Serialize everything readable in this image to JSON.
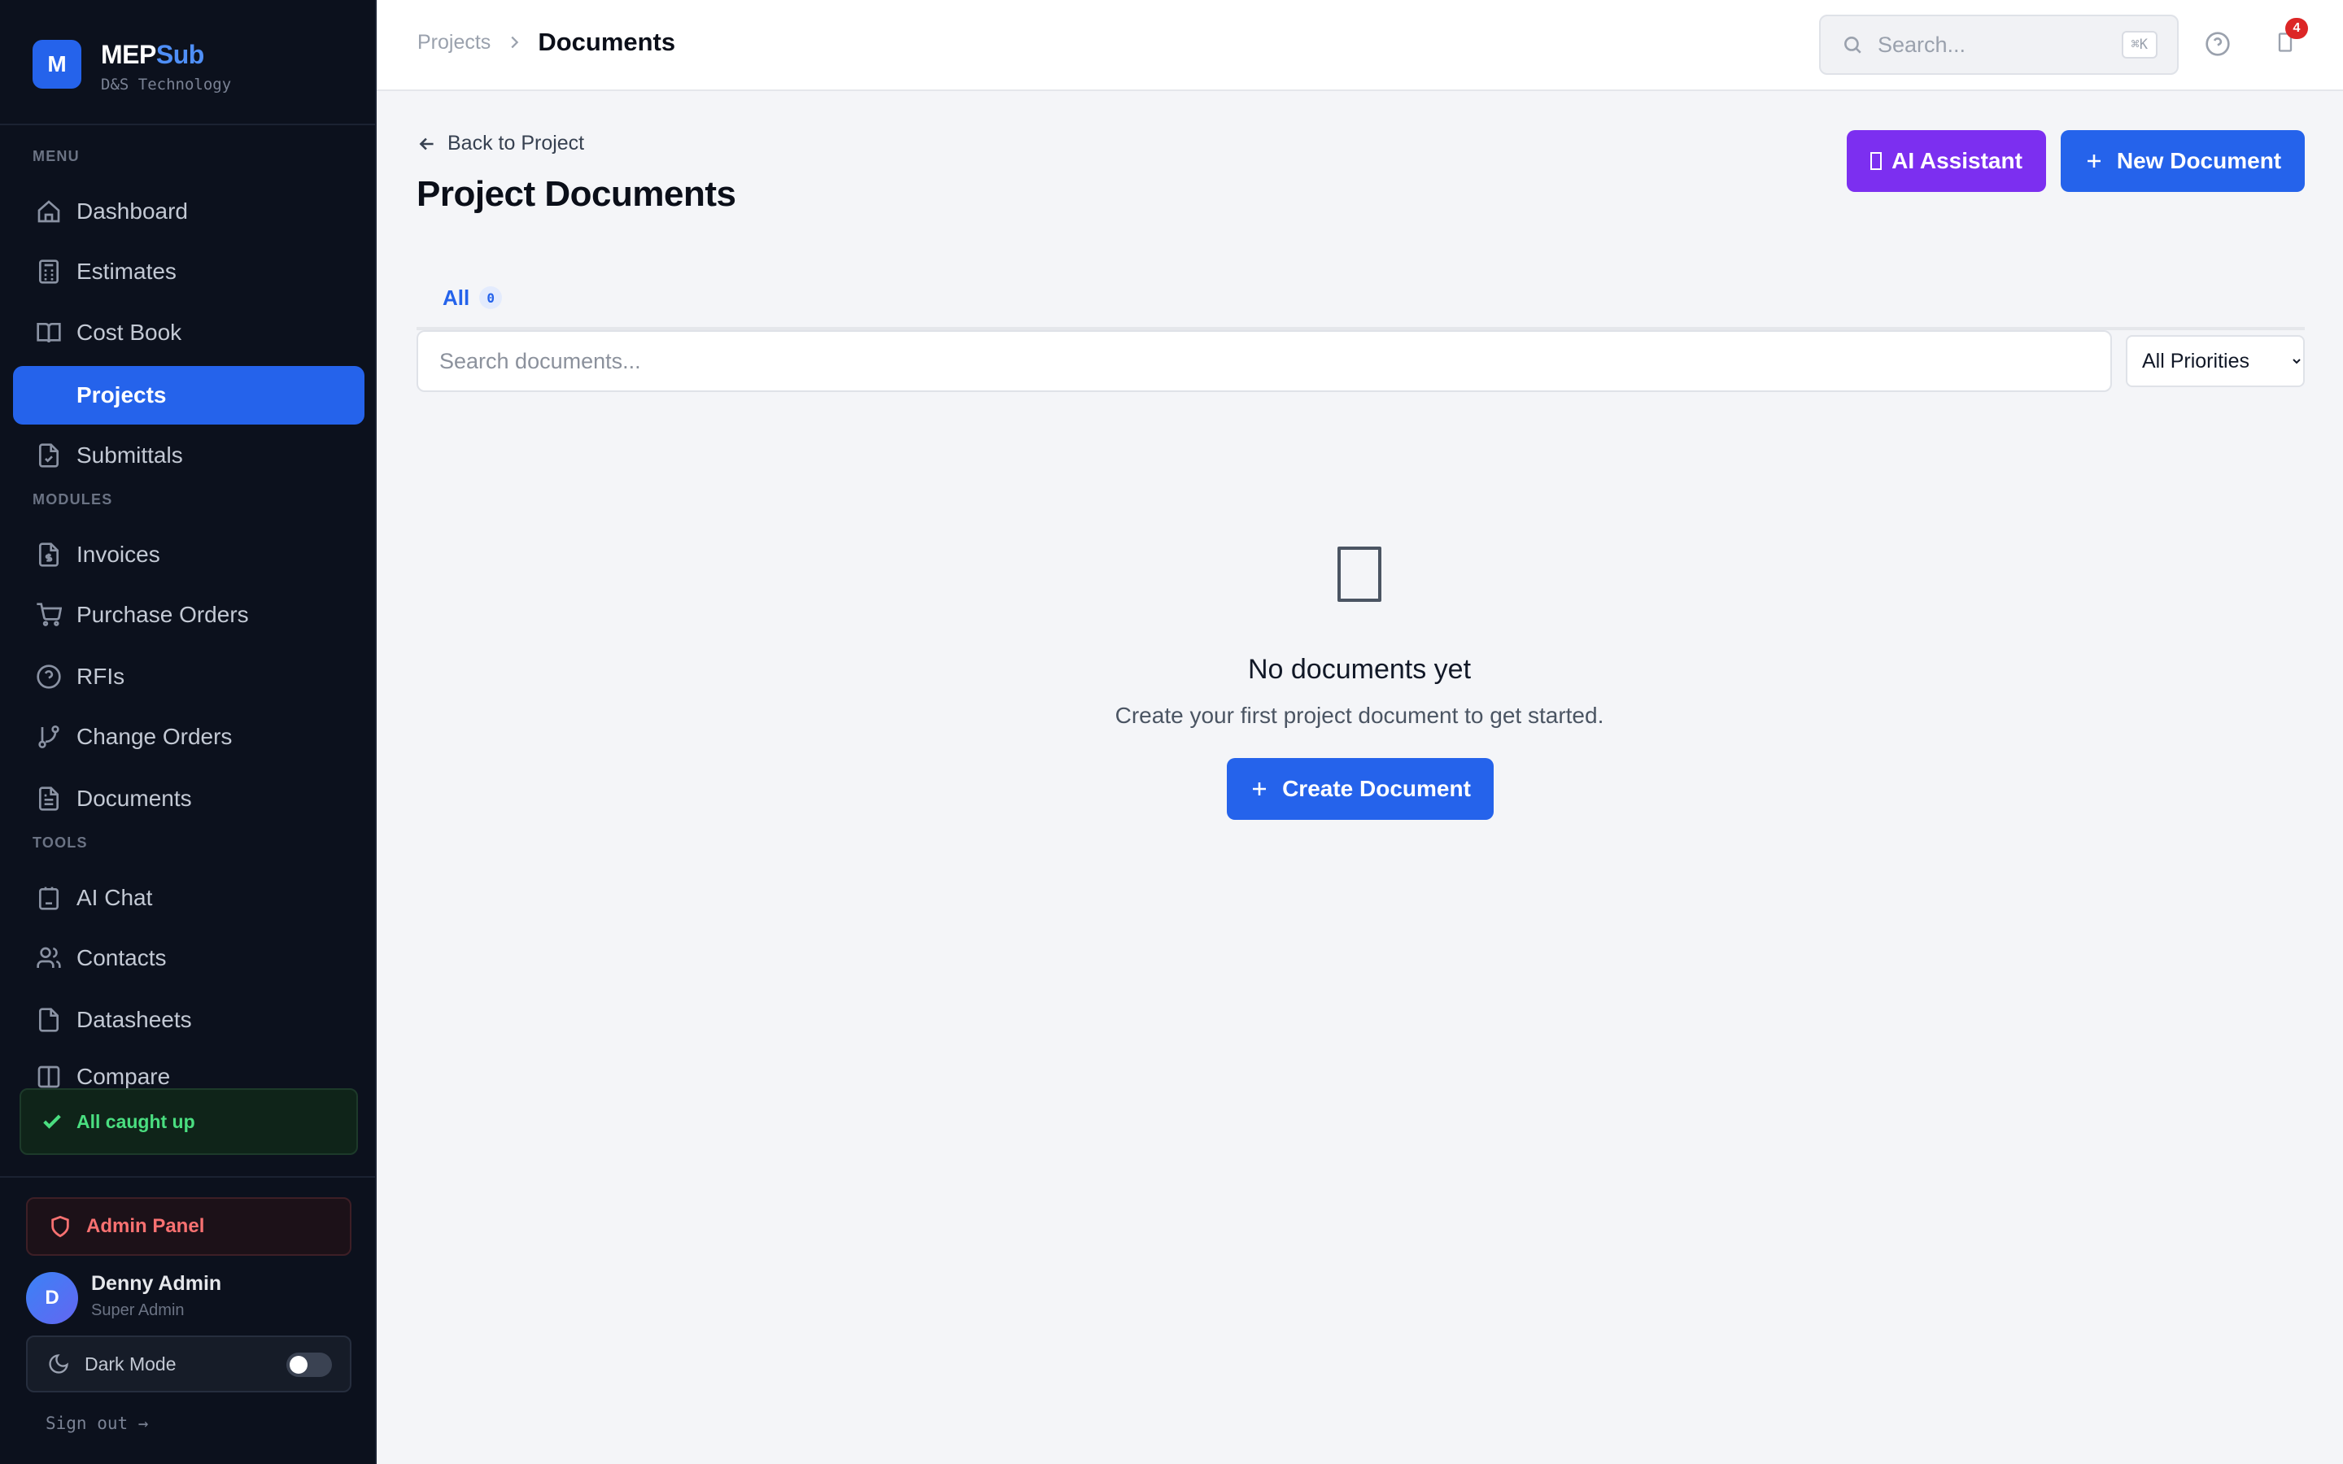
{
  "brand": {
    "logo_letter": "M",
    "name_part1": "MEP",
    "name_part2": "Sub",
    "company": "D&S Technology"
  },
  "sidebar": {
    "menu_label": "MENU",
    "menu": [
      {
        "label": "Dashboard",
        "icon": "home-icon"
      },
      {
        "label": "Estimates",
        "icon": "calculator-icon"
      },
      {
        "label": "Cost Book",
        "icon": "book-icon"
      },
      {
        "label": "Projects",
        "icon": "folder-icon",
        "active": true
      },
      {
        "label": "Submittals",
        "icon": "file-check-icon"
      }
    ],
    "modules_label": "MODULES",
    "modules": [
      {
        "label": "Invoices",
        "icon": "invoice-icon"
      },
      {
        "label": "Purchase Orders",
        "icon": "cart-icon"
      },
      {
        "label": "RFIs",
        "icon": "help-circle-icon"
      },
      {
        "label": "Change Orders",
        "icon": "git-branch-icon"
      },
      {
        "label": "Documents",
        "icon": "document-icon"
      }
    ],
    "tools_label": "TOOLS",
    "tools": [
      {
        "label": "AI Chat",
        "icon": "bot-icon"
      },
      {
        "label": "Contacts",
        "icon": "users-icon"
      },
      {
        "label": "Datasheets",
        "icon": "file-icon"
      },
      {
        "label": "Compare",
        "icon": "compare-icon"
      }
    ],
    "status": "All caught up",
    "admin_panel": "Admin Panel",
    "user": {
      "initial": "D",
      "name": "Denny Admin",
      "role": "Super Admin"
    },
    "dark_mode": {
      "label": "Dark Mode",
      "enabled": false
    },
    "sign_out": "Sign out →"
  },
  "header": {
    "breadcrumb_parent": "Projects",
    "breadcrumb_current": "Documents",
    "search_placeholder": "Search...",
    "search_shortcut": "⌘K",
    "notification_count": "4"
  },
  "main": {
    "back_link": "Back to Project",
    "title": "Project Documents",
    "ai_button": "AI Assistant",
    "new_button": "New Document",
    "tabs": [
      {
        "label": "All",
        "count": "0"
      }
    ],
    "search_placeholder": "Search documents...",
    "priority_filter": {
      "selected": "All Priorities"
    },
    "empty": {
      "title": "No documents yet",
      "description": "Create your first project document to get started.",
      "button": "Create Document"
    }
  },
  "colors": {
    "accent": "#2563eb",
    "ai_purple": "#7c2ff0",
    "sidebar_bg": "#0c111d",
    "success": "#4ade80",
    "danger": "#f87171"
  }
}
